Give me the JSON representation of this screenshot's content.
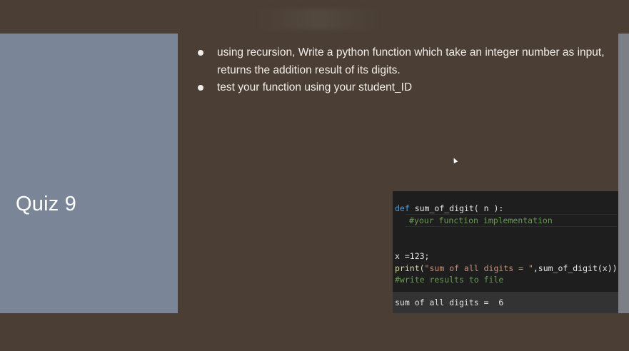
{
  "slide": {
    "title": "Quiz 9",
    "bullets": [
      "using recursion, Write a python function which take an integer number as input, returns the addition result of its digits.",
      "test your function using your student_ID"
    ]
  },
  "code": {
    "line1_kw": "def",
    "line1_rest": " sum_of_digit( n ):",
    "line2": "#your function implementation",
    "line3": "x =123;",
    "line4_print": "print(",
    "line4_str": "\"sum of all digits = \"",
    "line4_rest": ",sum_of_digit(x))",
    "line5": "#write results to file",
    "output": "sum of all digits =  6"
  },
  "colors": {
    "background": "#4b3f35",
    "left_panel": "#7a8698",
    "code_bg": "#1e1e1e",
    "keyword": "#569cd6",
    "comment": "#6a9955"
  }
}
